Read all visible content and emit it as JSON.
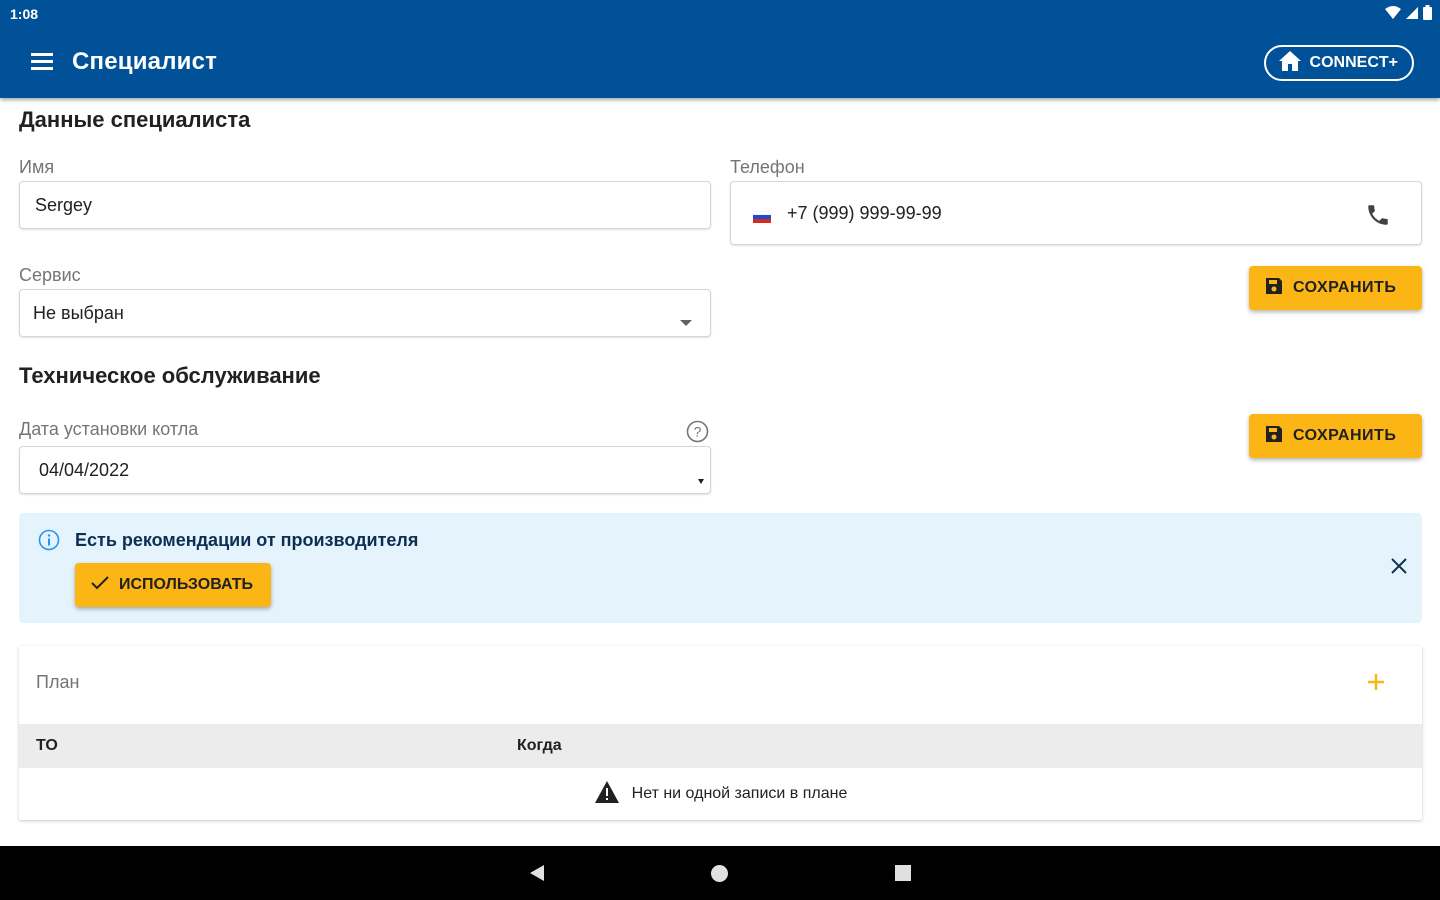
{
  "status_bar": {
    "time": "1:08"
  },
  "app_bar": {
    "title": "Специалист",
    "connect_label": "CONNECT+"
  },
  "specialist": {
    "section_title": "Данные специалиста",
    "name_label": "Имя",
    "name_value": "Sergey",
    "phone_label": "Телефон",
    "phone_value": "+7 (999) 999-99-99",
    "service_label": "Сервис",
    "service_value": "Не выбран",
    "save_label": "СОХРАНИТЬ"
  },
  "maintenance": {
    "section_title": "Техническое обслуживание",
    "date_label": "Дата установки котла",
    "date_value": "04/04/2022",
    "save_label": "СОХРАНИТЬ"
  },
  "alert": {
    "text": "Есть рекомендации от производителя",
    "use_label": "ИСПОЛЬЗОВАТЬ"
  },
  "plan": {
    "title": "План",
    "columns": [
      "ТО",
      "Когда"
    ],
    "empty_text": "Нет ни одной записи в плане"
  },
  "colors": {
    "primary": "#005198",
    "accent": "#fbb615",
    "alert_bg": "#e5f3fd"
  }
}
